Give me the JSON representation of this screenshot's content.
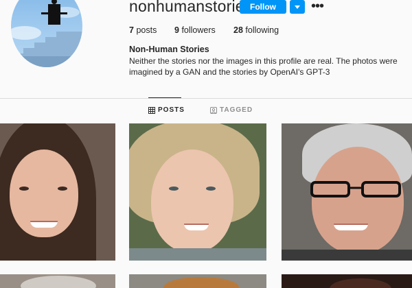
{
  "profile": {
    "username": "nonhumanstories",
    "follow_label": "Follow",
    "more_options_icon": "ellipsis-icon",
    "dropdown_icon": "chevron-down-icon",
    "stats": [
      {
        "count": "7",
        "label": "posts"
      },
      {
        "count": "9",
        "label": "followers"
      },
      {
        "count": "28",
        "label": "following"
      }
    ],
    "bio_name": "Non-Human Stories",
    "bio_text": "Neither the stories nor the images in this profile are real. The photos were imagined by a GAN and the stories by OpenAI's GPT-3"
  },
  "tabs": [
    {
      "label": "POSTS",
      "icon": "grid-icon",
      "active": true
    },
    {
      "label": "TAGGED",
      "icon": "tag-icon",
      "active": false
    }
  ],
  "colors": {
    "accent": "#0095f6",
    "background": "#fafafa",
    "text": "#262626",
    "muted": "#8e8e8e"
  }
}
